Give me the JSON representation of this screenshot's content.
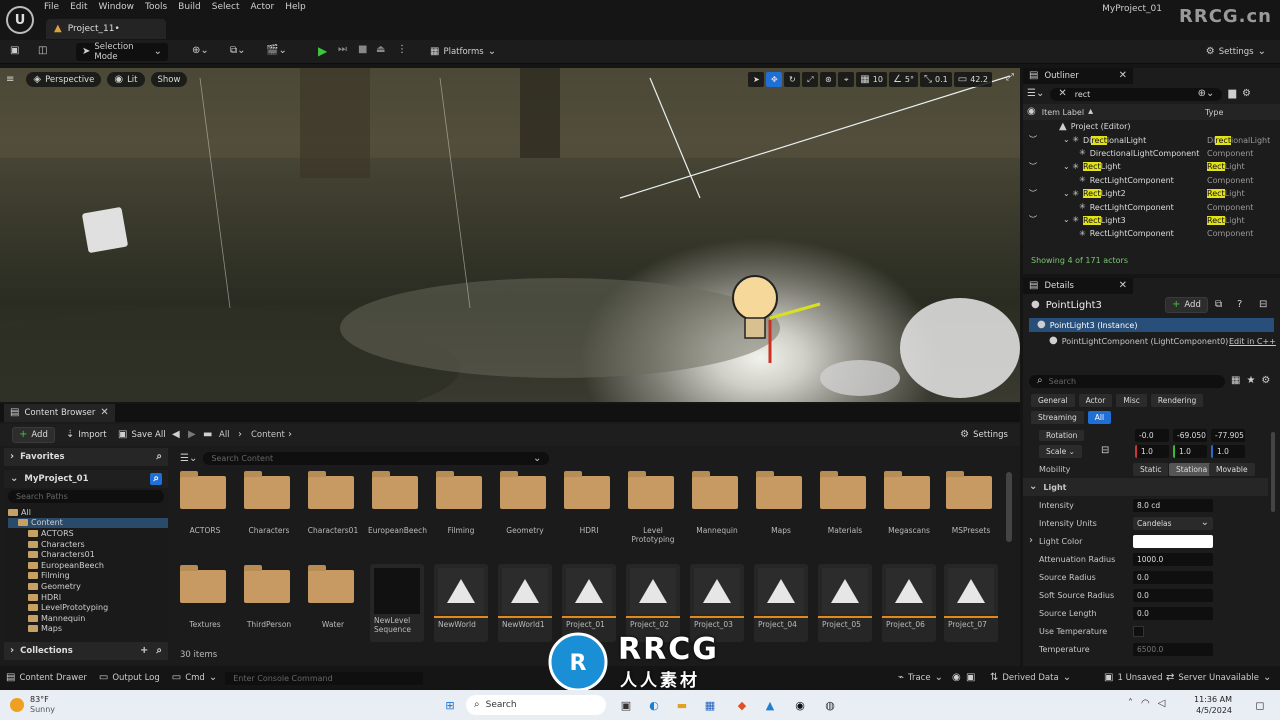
{
  "menubar": {
    "items": [
      "File",
      "Edit",
      "Window",
      "Tools",
      "Build",
      "Select",
      "Actor",
      "Help"
    ],
    "project_tab": "Project_11•",
    "project_name": "MyProject_01",
    "watermark": "RRCG.cn"
  },
  "toolbar": {
    "selection_mode": "Selection Mode",
    "platforms": "Platforms",
    "settings": "Settings"
  },
  "viewport": {
    "perspective": "Perspective",
    "lit": "Lit",
    "show": "Show",
    "grid_snap": "10",
    "rot_snap": "5°",
    "scale_snap": "0.1",
    "camera_speed": "42.2"
  },
  "content_browser": {
    "tab": "Content Browser",
    "add": "Add",
    "import": "Import",
    "save_all": "Save All",
    "path": [
      "All",
      "Content"
    ],
    "settings": "Settings",
    "favorites": "Favorites",
    "project": "MyProject_01",
    "search_paths": "Search Paths",
    "search_content": "Search Content",
    "tree": [
      "All",
      "Content",
      "ACTORS",
      "Characters",
      "Characters01",
      "EuropeanBeech",
      "Filming",
      "Geometry",
      "HDRI",
      "LevelPrototyping",
      "Mannequin",
      "Maps"
    ],
    "collections": "Collections",
    "folders_row1": [
      "ACTORS",
      "Characters",
      "Characters01",
      "EuropeanBeech",
      "Filming",
      "Geometry",
      "HDRI",
      "Level Prototyping",
      "Mannequin",
      "Maps",
      "Materials",
      "Megascans",
      "MSPresets"
    ],
    "folders_row2": [
      "Textures",
      "ThirdPerson",
      "Water"
    ],
    "assets_row2": [
      "NewLevel Sequence",
      "NewWorld",
      "NewWorld1",
      "Project_01",
      "Project_02",
      "Project_03",
      "Project_04",
      "Project_05",
      "Project_06",
      "Project_07"
    ],
    "item_count": "30 items"
  },
  "statusbar": {
    "content_drawer": "Content Drawer",
    "output_log": "Output Log",
    "cmd": "Cmd",
    "console_placeholder": "Enter Console Command",
    "trace": "Trace",
    "derived_data": "Derived Data",
    "unsaved": "1 Unsaved",
    "source_control": "Server Unavailable"
  },
  "outliner": {
    "tab": "Outliner",
    "filter": "rect",
    "col_label": "Item Label",
    "col_type": "Type",
    "root": "Project (Editor)",
    "rows": [
      {
        "pre": "Di",
        "hl": "rect",
        "post": "ionalLight",
        "type_pre": "Di",
        "type_hl": "rect",
        "type_post": "ionalLight",
        "indent": 1
      },
      {
        "pre": "DirectionalLightComponent",
        "hl": "",
        "post": "",
        "type_pre": "Component",
        "type_hl": "",
        "type_post": "",
        "indent": 2
      },
      {
        "pre": "",
        "hl": "Rect",
        "post": "Light",
        "type_pre": "",
        "type_hl": "Rect",
        "type_post": "Light",
        "indent": 1
      },
      {
        "pre": "RectLightComponent",
        "hl": "",
        "post": "",
        "type_pre": "Component",
        "type_hl": "",
        "type_post": "",
        "indent": 2
      },
      {
        "pre": "",
        "hl": "Rect",
        "post": "Light2",
        "type_pre": "",
        "type_hl": "Rect",
        "type_post": "Light",
        "indent": 1
      },
      {
        "pre": "RectLightComponent",
        "hl": "",
        "post": "",
        "type_pre": "Component",
        "type_hl": "",
        "type_post": "",
        "indent": 2
      },
      {
        "pre": "",
        "hl": "Rect",
        "post": "Light3",
        "type_pre": "",
        "type_hl": "Rect",
        "type_post": "Light",
        "indent": 1
      },
      {
        "pre": "RectLightComponent",
        "hl": "",
        "post": "",
        "type_pre": "Component",
        "type_hl": "",
        "type_post": "",
        "indent": 2
      }
    ],
    "showing": "Showing 4 of 171 actors"
  },
  "details": {
    "tab": "Details",
    "actor": "PointLight3",
    "add": "Add",
    "instance": "PointLight3 (Instance)",
    "component": "PointLightComponent (LightComponent0)",
    "edit_cpp": "Edit in C++",
    "search": "Search",
    "filters": [
      "General",
      "Actor",
      "Misc",
      "Rendering",
      "Streaming",
      "All"
    ],
    "rotation_label": "Rotation",
    "rotation": [
      "-0.0",
      "-69.050",
      "-77.905"
    ],
    "scale_label": "Scale",
    "scale": [
      "1.0",
      "1.0",
      "1.0"
    ],
    "mobility_label": "Mobility",
    "mobility": [
      "Static",
      "Stationa",
      "Movable"
    ],
    "section_light": "Light",
    "intensity_label": "Intensity",
    "intensity": "8.0 cd",
    "intensity_units_label": "Intensity Units",
    "intensity_units": "Candelas",
    "light_color_label": "Light Color",
    "attenuation_label": "Attenuation Radius",
    "attenuation": "1000.0",
    "source_radius_label": "Source Radius",
    "source_radius": "0.0",
    "soft_radius_label": "Soft Source Radius",
    "soft_radius": "0.0",
    "source_length_label": "Source Length",
    "source_length": "0.0",
    "use_temp_label": "Use Temperature",
    "temperature_label": "Temperature",
    "temperature": "6500.0"
  },
  "taskbar": {
    "weather_temp": "83°F",
    "weather_desc": "Sunny",
    "search": "Search",
    "time": "11:36 AM",
    "date": "4/5/2024"
  },
  "logo_text": {
    "big": "RRCG",
    "small": "人人素材"
  }
}
